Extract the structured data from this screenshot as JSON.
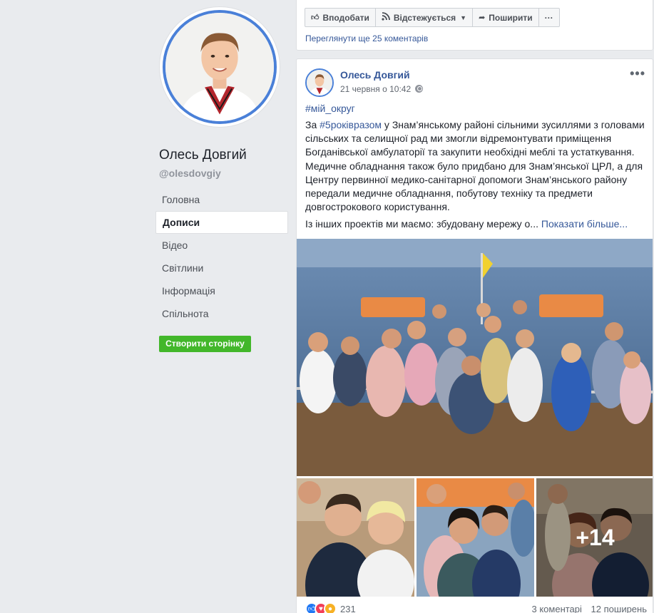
{
  "profile": {
    "name": "Олесь Довгий",
    "handle": "@olesdovgiy"
  },
  "nav": {
    "items": [
      {
        "label": "Головна"
      },
      {
        "label": "Дописи"
      },
      {
        "label": "Відео"
      },
      {
        "label": "Світлини"
      },
      {
        "label": "Інформація"
      },
      {
        "label": "Спільнота"
      }
    ],
    "active": "Дописи"
  },
  "create_page_label": "Створити сторінку",
  "toolbar": {
    "like_label": "Вподобати",
    "follow_label": "Відстежується",
    "share_label": "Поширити",
    "more_label": "···"
  },
  "comments_link": "Переглянути ще 25 коментарів",
  "post": {
    "author": "Олесь Довгий",
    "timestamp": "21 червня о 10:42",
    "hashtag_top": "#мій_округ",
    "text_intro": "За ",
    "text_tag": "#5роківразом",
    "text_body": " у Знам’янському районі сільними зусиллями з головами сільських та селищної рад ми змогли відремонтувати приміщення Богданівської амбулаторії та закупити необхідні меблі та устаткування. Медичне обладнання також було придбано для Знам’янської ЦРЛ, а для Центру первинної медико-санітарної допомоги Знам’янського району передали медичне обладнання, побутову техніку та предмети довгострокового користування.",
    "text_second": "Із інших проектів ми маємо: збудовану мережу о... ",
    "see_more": "Показати більше...",
    "extra_photos": "+14",
    "reactions_count": "231",
    "comments_count": "3 коментарі",
    "shares_count": "12 поширень"
  },
  "icons": {
    "like": "thumbs-up-icon",
    "follow": "rss-icon",
    "share": "share-arrow-icon",
    "globe": "globe-icon"
  },
  "colors": {
    "accent": "#4267b2",
    "link": "#365899",
    "green": "#42b72a",
    "background": "#e9ebee"
  }
}
